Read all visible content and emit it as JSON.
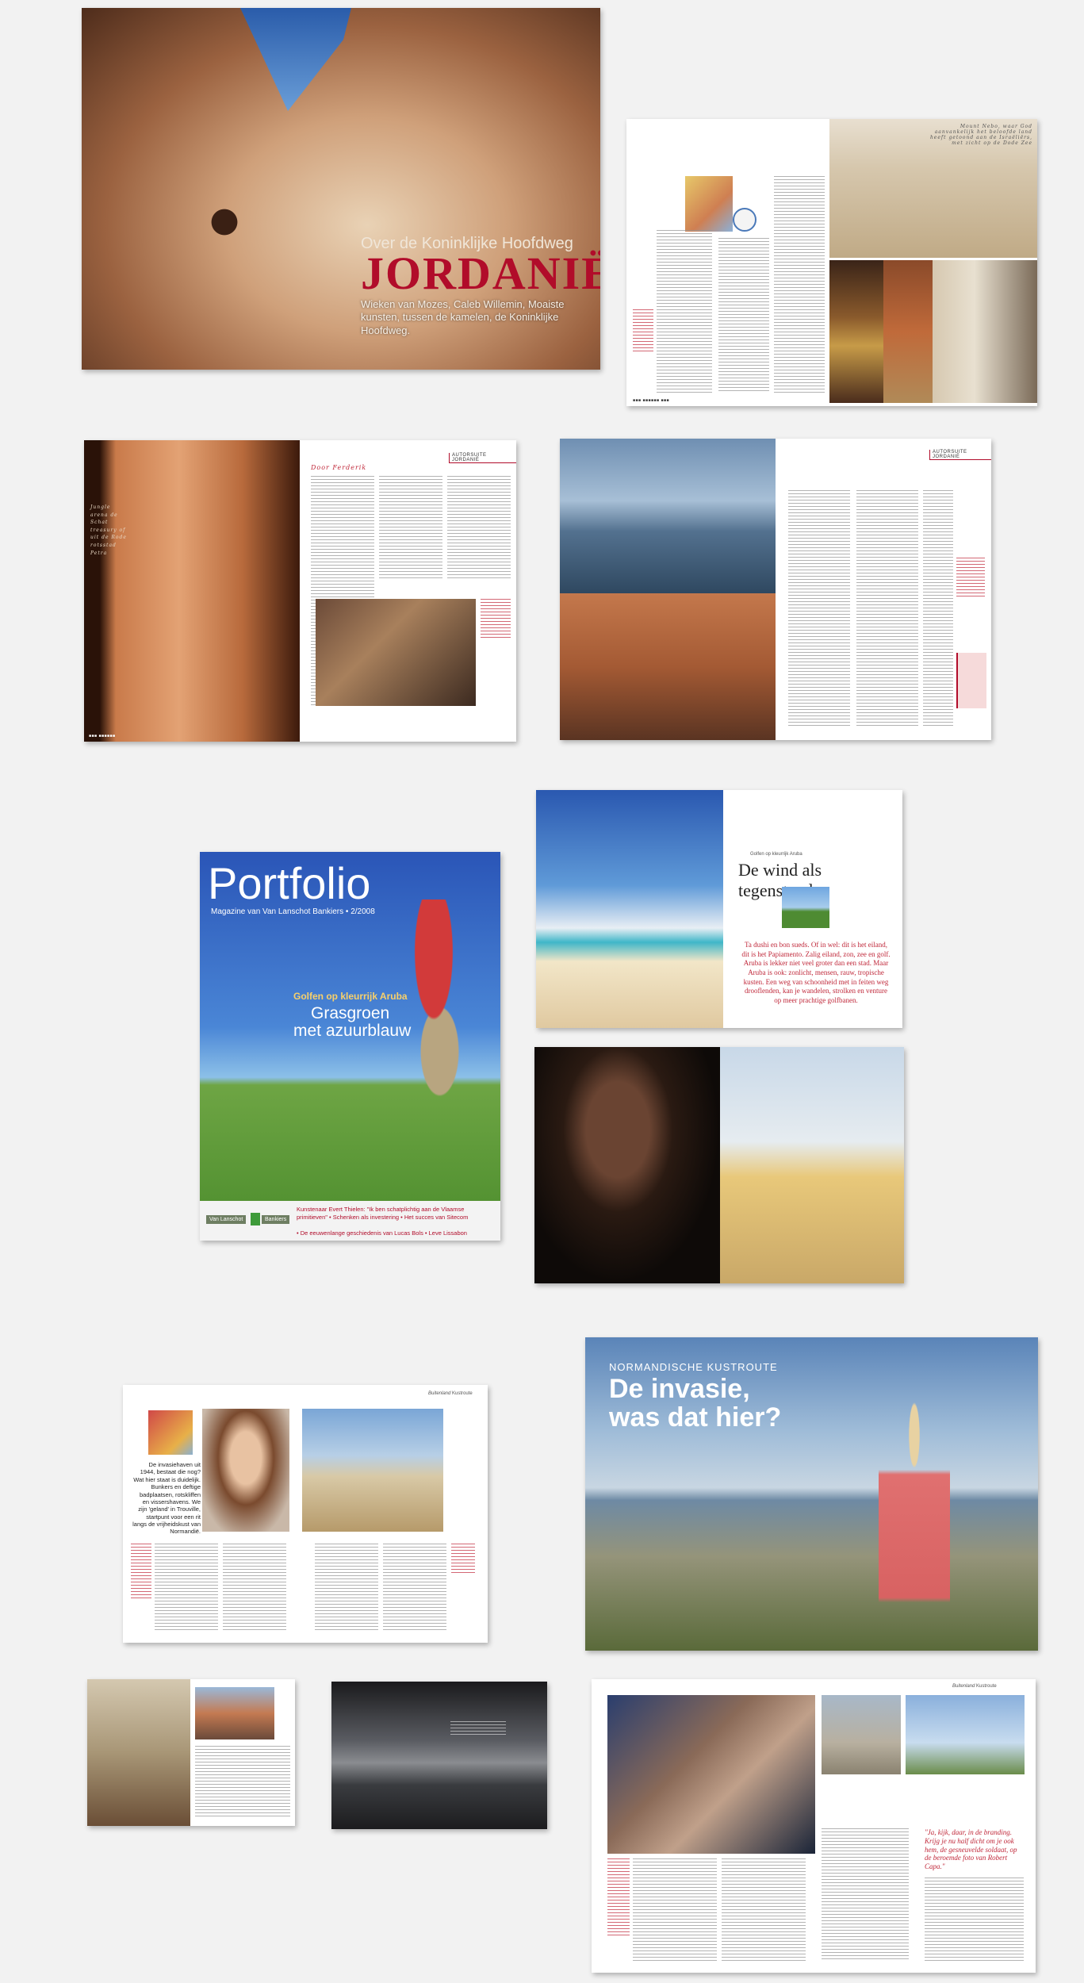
{
  "spreads": {
    "jordan_cover": {
      "kicker": "Over de Koninklijke Hoofdweg",
      "title": "JORDANIË",
      "intro": "Wieken van Mozes, Caleb Willemin, Moaiste kunsten, tussen de kamelen, de Koninklijke Hoofdweg."
    },
    "jordan_spread2": {
      "handwriting": "Mount Nebo, waar God aanvankelijk het beloofde land heeft getoond aan de Israëliërs, met zicht op de Dode Zee"
    },
    "jordan_spread3": {
      "handwriting_left": "Jungle arena de Schat treasury of uit de Rode rotsstad Petra",
      "byline": "Door Ferderik",
      "section": "AUTORSUITE JORDANIË"
    },
    "jordan_spread4": {
      "section": "AUTORSUITE JORDANIË"
    },
    "portfolio_cover": {
      "title": "Portfolio",
      "subtitle": "Magazine van Van Lanschot Bankiers • 2/2008",
      "kicker": "Golfen op kleurrijk Aruba",
      "headline_1": "Grasgroen",
      "headline_2": "met azuurblauw",
      "brand": "Van Lanschot",
      "brand_suffix": "Bankiers",
      "footer_1": "Kunstenaar Evert Thielen: \"Ik ben schatplichtig aan de Vlaamse primitieven\" • Schenken als investering • Het succes van Sitecom",
      "footer_2": "• De eeuwenlange geschiedenis van Lucas Bols • Leve Lissabon"
    },
    "aruba_spread": {
      "kicker": "Golfen op kleurrijk Aruba",
      "title": "De wind als tegenstander",
      "intro": "Ta dushi en bon sueds. Of in wel: dit is het eiland, dit is het Papiamento. Zalig eiland, zon, zee en golf. Aruba is lekker niet veel groter dan een stad. Maar Aruba is ook: zonlicht, mensen, rauw, tropische kusten. Een weg van schoonheid met in feiten weg drooflenden, kan je wandelen, strolken en venture op meer prachtige golfbanen."
    },
    "normandy_spread1": {
      "section": "Kustroute",
      "section_prefix": "Buitenland",
      "intro": "De invasiehaven uit 1944, bestaat die nog? Wat hier staat is duidelijk. Bunkers en deftige badplaatsen, rotskliffen en vissershavens. We zijn 'geland' in Trouville, startpunt voor een rit langs de vrijheidskust van Normandië."
    },
    "normandy_cover": {
      "kicker": "NORMANDISCHE KUSTROUTE",
      "title_1": "De invasie,",
      "title_2": "was dat hier?"
    },
    "normandy_spread4": {
      "section": "Kustroute",
      "section_prefix": "Buitenland",
      "quote": "\"Ja, kijk, daar, in de branding. Krijg je nu half dicht om je ook hem, de gesneuvelde soldaat, op de beroemde foto van Robert Capa.\""
    }
  }
}
